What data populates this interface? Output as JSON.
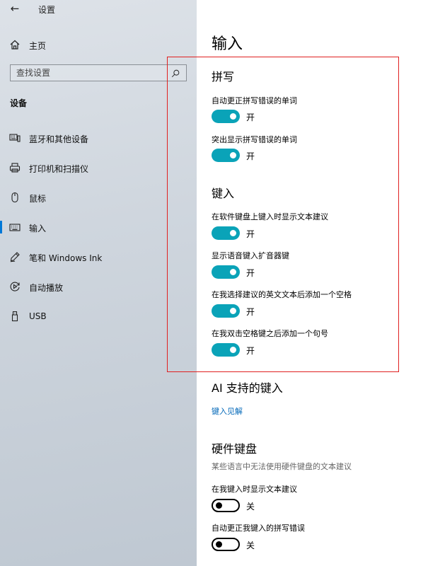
{
  "window": {
    "back_glyph": "←",
    "title": "设置"
  },
  "sidebar": {
    "home_label": "主页",
    "search_placeholder": "查找设置",
    "section_title": "设备",
    "items": [
      {
        "label": "蓝牙和其他设备",
        "icon": "bluetooth-devices-icon"
      },
      {
        "label": "打印机和扫描仪",
        "icon": "printer-icon"
      },
      {
        "label": "鼠标",
        "icon": "mouse-icon"
      },
      {
        "label": "输入",
        "icon": "keyboard-icon",
        "active": true
      },
      {
        "label": "笔和 Windows Ink",
        "icon": "pen-icon"
      },
      {
        "label": "自动播放",
        "icon": "autoplay-icon"
      },
      {
        "label": "USB",
        "icon": "usb-icon"
      }
    ],
    "accent_color": "#0078d7"
  },
  "main": {
    "page_title": "输入",
    "spelling": {
      "title": "拼写",
      "autocorrect_label": "自动更正拼写错误的单词",
      "autocorrect_state": "开",
      "highlight_label": "突出显示拼写错误的单词",
      "highlight_state": "开"
    },
    "typing": {
      "title": "键入",
      "soft_kb_suggest_label": "在软件键盘上键入时显示文本建议",
      "soft_kb_suggest_state": "开",
      "voice_key_label": "显示语音键入扩音器键",
      "voice_key_state": "开",
      "add_space_label": "在我选择建议的英文文本后添加一个空格",
      "add_space_state": "开",
      "double_space_label": "在我双击空格键之后添加一个句号",
      "double_space_state": "开"
    },
    "ai_typing": {
      "title": "AI 支持的键入",
      "link": "键入见解"
    },
    "hardware_keyboard": {
      "title": "硬件键盘",
      "description": "某些语言中无法使用硬件键盘的文本建议",
      "show_suggest_label": "在我键入时显示文本建议",
      "show_suggest_state": "关",
      "autocorrect_label": "自动更正我键入的拼写错误",
      "autocorrect_state": "关"
    },
    "toggle_on_color": "#0aa3b8",
    "highlight_box_color": "#e02020"
  }
}
